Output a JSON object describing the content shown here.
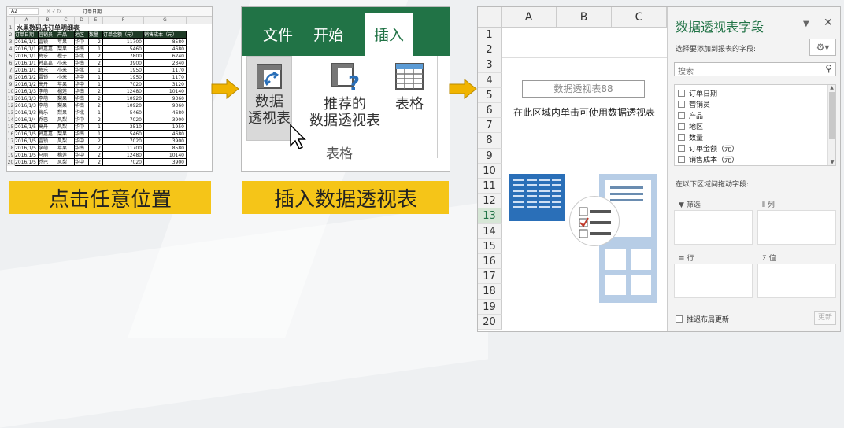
{
  "step1": {
    "name_box": "A2",
    "fx_label": "×  ✓  fx",
    "formula_value": "订单日期",
    "columns": [
      "A",
      "B",
      "C",
      "D",
      "E",
      "F",
      "G"
    ],
    "title": "水果数码店订单明细表",
    "headers": [
      "订单日期",
      "营销员",
      "产品",
      "地区",
      "数量",
      "订单金额（元）",
      "销售成本（元）"
    ],
    "rows": [
      [
        "2016/1/1",
        "雷锁",
        "苹果",
        "华中",
        "2",
        "11700",
        "8580"
      ],
      [
        "2016/1/1",
        "韩嘉嘉",
        "梨果",
        "华南",
        "1",
        "5460",
        "4680"
      ],
      [
        "2016/1/1",
        "梅乐",
        "橙子",
        "华北",
        "2",
        "7800",
        "6240"
      ],
      [
        "2016/1/1",
        "韩嘉嘉",
        "小米",
        "华南",
        "2",
        "3900",
        "2340"
      ],
      [
        "2016/1/1",
        "梅乐",
        "小米",
        "华北",
        "1",
        "1950",
        "1170"
      ],
      [
        "2016/1/2",
        "雷锁",
        "小米",
        "华中",
        "1",
        "1950",
        "1170"
      ],
      [
        "2016/1/2",
        "高丹",
        "苹果",
        "华中",
        "1",
        "7020",
        "3120"
      ],
      [
        "2016/1/3",
        "李萌",
        "榴莲",
        "华南",
        "2",
        "12480",
        "10140"
      ],
      [
        "2016/1/3",
        "李萌",
        "梨果",
        "华南",
        "2",
        "10920",
        "9360"
      ],
      [
        "2016/1/3",
        "李萌",
        "梨果",
        "华南",
        "2",
        "10920",
        "9360"
      ],
      [
        "2016/1/3",
        "梅乐",
        "梨果",
        "华北",
        "1",
        "5460",
        "4680"
      ],
      [
        "2016/1/4",
        "乔巴",
        "风梨",
        "华中",
        "2",
        "7020",
        "3900"
      ],
      [
        "2016/1/5",
        "高丹",
        "风梨",
        "华中",
        "1",
        "3510",
        "1950"
      ],
      [
        "2016/1/5",
        "韩嘉嘉",
        "梨果",
        "华南",
        "1",
        "5460",
        "4680"
      ],
      [
        "2016/1/5",
        "雷锁",
        "风梨",
        "华中",
        "2",
        "7020",
        "3900"
      ],
      [
        "2016/1/5",
        "李萌",
        "苹果",
        "华南",
        "2",
        "11700",
        "8580"
      ],
      [
        "2016/1/5",
        "马丽",
        "榴莲",
        "华中",
        "2",
        "12480",
        "10140"
      ],
      [
        "2016/1/5",
        "乔巴",
        "风梨",
        "华中",
        "2",
        "7020",
        "3900"
      ]
    ],
    "caption": "点击任意位置"
  },
  "step2": {
    "tabs": [
      "文件",
      "开始",
      "插入"
    ],
    "active_tab": "插入",
    "buttons": {
      "pivot": [
        "数据",
        "透视表"
      ],
      "recommended": [
        "推荐的",
        "数据透视表"
      ],
      "table": "表格"
    },
    "group_label": "表格",
    "caption": "插入数据透视表"
  },
  "step3": {
    "columns": [
      "A",
      "B",
      "C"
    ],
    "rows": [
      "1",
      "2",
      "3",
      "4",
      "5",
      "6",
      "7",
      "8",
      "9",
      "10",
      "11",
      "12",
      "13",
      "14",
      "15",
      "16",
      "17",
      "18",
      "19",
      "20"
    ],
    "selected_row": "13",
    "pivot_name": "数据透视表88",
    "pivot_hint": "在此区域内单击可使用数据透视表",
    "pane": {
      "title": "数据透视表字段",
      "choose_label": "选择要添加到报表的字段:",
      "search_placeholder": "搜索",
      "fields": [
        "订单日期",
        "营销员",
        "产品",
        "地区",
        "数量",
        "订单金额（元）",
        "销售成本（元）"
      ],
      "drag_label": "在以下区域间拖动字段:",
      "zones": [
        "筛选",
        "列",
        "行",
        "值"
      ],
      "defer_label": "推迟布局更新",
      "update_label": "更新"
    }
  },
  "colors": {
    "excel_green": "#217346",
    "yellow": "#f5c518",
    "arrow": "#f0b400",
    "header_dark": "#1e3a26",
    "icon_blue": "#4a86c6"
  }
}
